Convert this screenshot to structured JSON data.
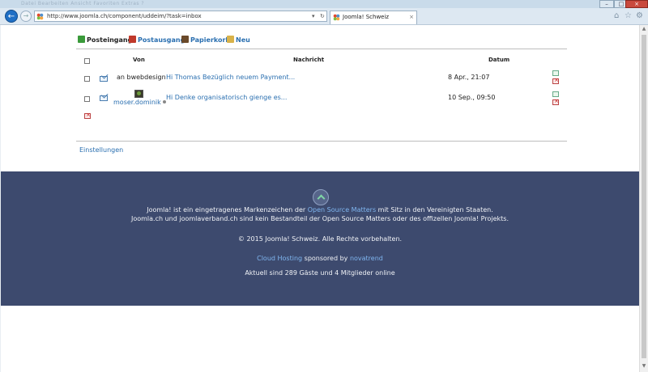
{
  "browser": {
    "title_faint": "Datei   Bearbeiten   Ansicht   Favoriten   Extras   ?",
    "url": "http://www.joomla.ch/component/uddeim/?task=inbox",
    "addr_search_glyph": "▾",
    "addr_refresh_glyph": "↻",
    "tab_title": "Joomla! Schweiz",
    "tab_close": "×",
    "back_glyph": "←",
    "forward_glyph": "→",
    "win_min": "–",
    "win_max": "□",
    "win_close": "×",
    "home_glyph": "⌂",
    "favorites_glyph": "☆",
    "settings_glyph": "⚙",
    "scroll_up": "▲",
    "scroll_down": "▼"
  },
  "mailbox": {
    "nav": [
      {
        "label": "Posteingang",
        "icon": "inbox-icon",
        "color": "#3a9a3a",
        "active": true
      },
      {
        "label": "Postausgang",
        "icon": "outbox-icon",
        "color": "#c0392b",
        "active": false
      },
      {
        "label": "Papierkorb",
        "icon": "trash-icon",
        "color": "#6b4a2a",
        "active": false
      },
      {
        "label": "Neu",
        "icon": "new-message-icon",
        "color": "#d8b24a",
        "active": false
      }
    ],
    "columns": {
      "from": "Von",
      "message": "Nachricht",
      "date": "Datum"
    },
    "rows": [
      {
        "from": "an bwebdesign",
        "message": "Hi Thomas Bezüglich neuem Payment...",
        "date": "8 Apr., 21:07"
      },
      {
        "from": "moser.dominik",
        "message": "Hi Denke organisatorisch gienge es...",
        "date": "10 Sep., 09:50"
      }
    ],
    "settings_link": "Einstellungen"
  },
  "footer": {
    "line1_pre": "Joomla! ist ein eingetragenes Markenzeichen der ",
    "line1_link": "Open Source Matters",
    "line1_post": " mit Sitz in den Vereinigten Staaten.",
    "line2": "Joomla.ch und joomlaverband.ch sind kein Bestandteil der Open Source Matters oder des offizellen Joomla! Projekts.",
    "copyright": "© 2015 Joomla! Schweiz. Alle Rechte vorbehalten.",
    "hosting_link": "Cloud Hosting",
    "sponsored": " sponsored by ",
    "sponsor_link": "novatrend",
    "online": "Aktuell sind 289 Gäste und 4 Mitglieder online"
  },
  "colors": {
    "footer_bg": "#3d4a6e",
    "link": "#2a6fb0",
    "footer_link": "#7fb6f0"
  }
}
